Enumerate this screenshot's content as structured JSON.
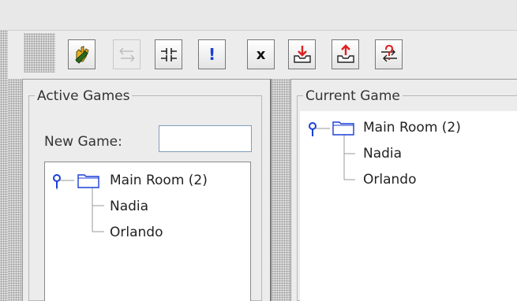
{
  "toolbar": {
    "buttons": [
      {
        "name": "connect-button",
        "icon": "hand-flag-icon",
        "enabled": true
      },
      {
        "name": "swap-button",
        "icon": "swap-arrows-icon",
        "enabled": false
      },
      {
        "name": "split-button",
        "icon": "split-icon",
        "enabled": true
      },
      {
        "name": "alert-button",
        "icon": "exclamation-icon",
        "glyph": "!",
        "enabled": true
      },
      {
        "name": "close-button",
        "icon": "x-icon",
        "glyph": "x",
        "enabled": true
      },
      {
        "name": "download-button",
        "icon": "download-tray-icon",
        "enabled": true
      },
      {
        "name": "upload-button",
        "icon": "upload-tray-icon",
        "enabled": true
      },
      {
        "name": "help-transfer-button",
        "icon": "question-arrows-icon",
        "enabled": true
      }
    ]
  },
  "active_games": {
    "title": "Active Games",
    "new_game_label": "New Game:",
    "new_game_value": "",
    "tree": {
      "root": "Main Room (2)",
      "children": [
        "Nadia",
        "Orlando"
      ]
    }
  },
  "current_game": {
    "title": "Current Game",
    "tree": {
      "root": "Main Room (2)",
      "children": [
        "Nadia",
        "Orlando"
      ]
    }
  },
  "colors": {
    "accent_blue": "#1a3fd6",
    "download_red": "#e02020"
  }
}
